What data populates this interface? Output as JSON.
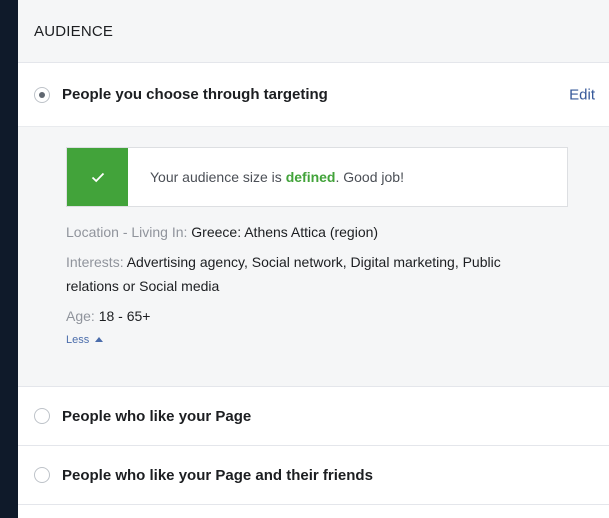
{
  "audience": {
    "heading": "AUDIENCE",
    "options": [
      {
        "label": "People you choose through targeting",
        "selected": true,
        "action": "Edit"
      },
      {
        "label": "People who like your Page",
        "selected": false
      },
      {
        "label": "People who like your Page and their friends",
        "selected": false
      }
    ],
    "notice": {
      "before": "Your audience size is ",
      "highlight": "defined",
      "after": ". Good job!",
      "accent_color": "#42a33a",
      "icon": "checkmark-icon"
    },
    "details": {
      "location_label": "Location - Living In: ",
      "location_value": "Greece: Athens Attica (region)",
      "interests_label": "Interests: ",
      "interests_value": "Advertising agency, Social network, Digital marketing, Public relations or Social media",
      "age_label": "Age: ",
      "age_value": "18 - 65+"
    },
    "toggle_label": "Less"
  }
}
